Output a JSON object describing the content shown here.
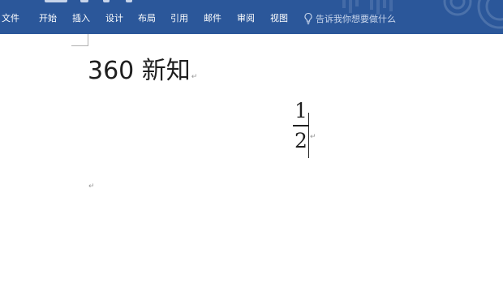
{
  "ribbon": {
    "tabs": [
      {
        "label": "文件"
      },
      {
        "label": "开始"
      },
      {
        "label": "插入"
      },
      {
        "label": "设计"
      },
      {
        "label": "布局"
      },
      {
        "label": "引用"
      },
      {
        "label": "邮件"
      },
      {
        "label": "审阅"
      },
      {
        "label": "视图"
      }
    ],
    "tell_me": {
      "icon": "lightbulb-icon",
      "text": "告诉我你想要做什么"
    },
    "colors": {
      "background": "#2b579a",
      "tab_text": "#ffffff"
    }
  },
  "document": {
    "title": "360 新知",
    "paragraph_mark": "↵",
    "equation": {
      "numerator": "1",
      "denominator": "2"
    }
  }
}
